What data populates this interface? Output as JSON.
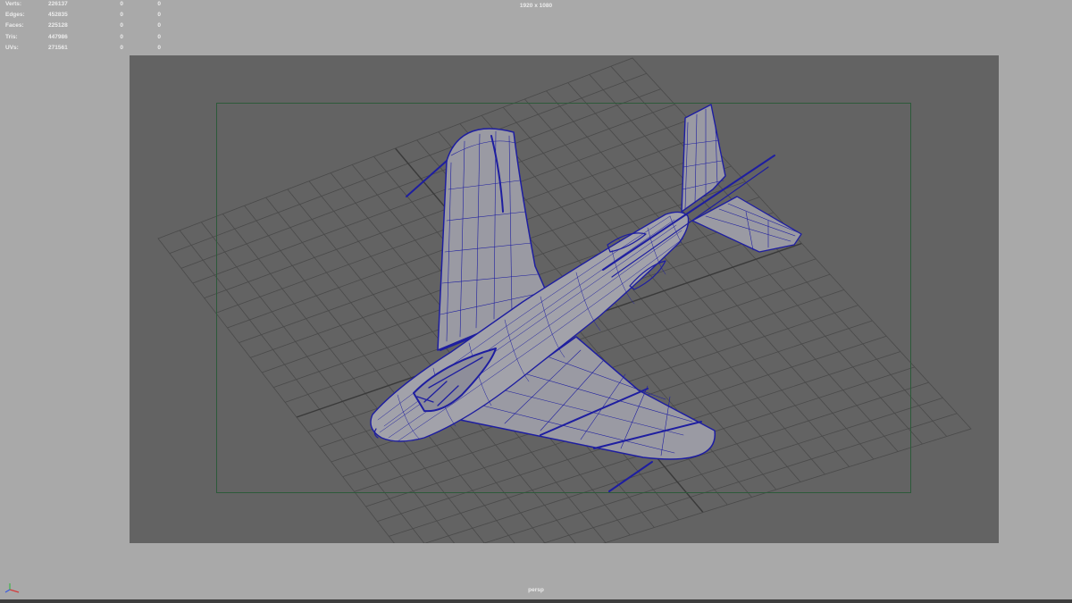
{
  "hud": {
    "rows": [
      {
        "label": "Verts:",
        "value": "226137",
        "sel": "0",
        "comp": "0"
      },
      {
        "label": "Edges:",
        "value": "452835",
        "sel": "0",
        "comp": "0"
      },
      {
        "label": "Faces:",
        "value": "225128",
        "sel": "0",
        "comp": "0"
      },
      {
        "label": "Tris:",
        "value": "447986",
        "sel": "0",
        "comp": "0"
      },
      {
        "label": "UVs:",
        "value": "271561",
        "sel": "0",
        "comp": "0"
      }
    ]
  },
  "viewport": {
    "resolution": "1920 x 1080",
    "camera": "persp",
    "wireframe_color": "#1e1ea0",
    "grid_color": "#454545",
    "background": "#636363",
    "page_background": "#a9a9a9"
  },
  "icons": {
    "axis": "xyz-axis-icon"
  }
}
